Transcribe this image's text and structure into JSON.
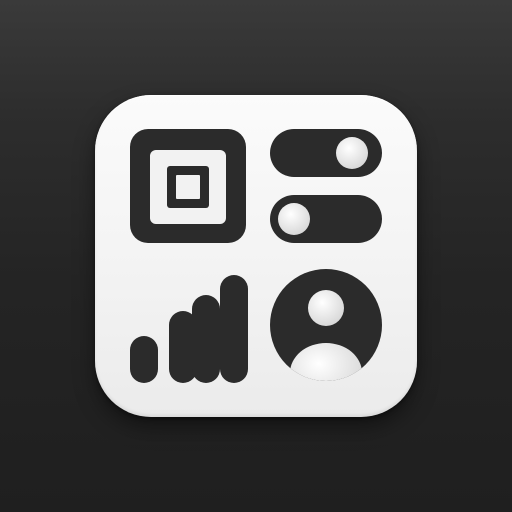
{
  "icons": {
    "app_icon": "control-center-app-icon",
    "square_button": "square-button-icon",
    "toggle_on": "toggle-switch-on-icon",
    "toggle_off": "toggle-switch-off-icon",
    "signal_bars": "signal-bars-icon",
    "user_avatar": "user-avatar-icon"
  },
  "toggles": [
    {
      "name": "toggle-top",
      "state": "on"
    },
    {
      "name": "toggle-bottom",
      "state": "off"
    }
  ],
  "signal": {
    "bars_filled": 4,
    "bars_total": 4
  },
  "colors": {
    "background_top": "#3a3a3a",
    "background_bottom": "#1f1f1f",
    "tile": "#f3f3f3",
    "glyph": "#2b2b2b",
    "knob": "#e9e9e9"
  }
}
